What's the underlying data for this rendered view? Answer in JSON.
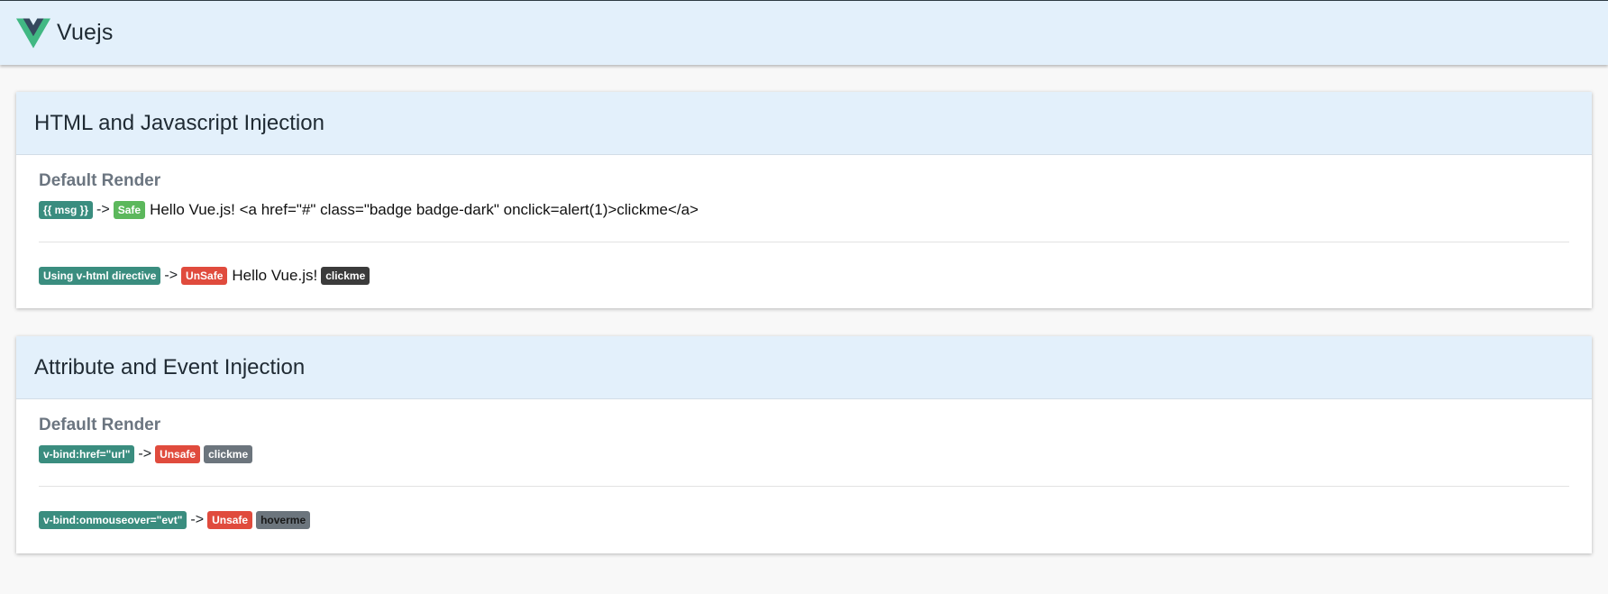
{
  "header": {
    "brand": "Vuejs",
    "logo_icon": "vue-logo-icon",
    "colors": {
      "logo_outer": "#41b883",
      "logo_inner": "#35495e",
      "bar_bg": "#e3f0fb"
    }
  },
  "cards": [
    {
      "title": "HTML and Javascript Injection",
      "section_title": "Default Render",
      "row1": {
        "badge1": "{{ msg }}",
        "arrow": "->",
        "badge2": "Safe",
        "text": "Hello Vue.js! <a href=\"#\" class=\"badge badge-dark\" onclick=alert(1)>clickme</a>"
      },
      "row2": {
        "badge1": "Using v-html directive",
        "arrow": "->",
        "badge2": "UnSafe",
        "text": "Hello Vue.js!",
        "link": "clickme"
      }
    },
    {
      "title": "Attribute and Event Injection",
      "section_title": "Default Render",
      "row1": {
        "badge1": "v-bind:href=\"url\"",
        "arrow": "->",
        "badge2": "Unsafe",
        "link": "clickme"
      },
      "row2": {
        "badge1": "v-bind:onmouseover=\"evt\"",
        "arrow": "->",
        "badge2": "Unsafe",
        "link": "hoverme"
      }
    }
  ],
  "colors": {
    "teal_badge": "#3a8d7f",
    "safe_badge": "#5cb85c",
    "unsafe_badge": "#e04b3d",
    "dark_badge": "#3b3b3b",
    "gray_badge": "#6c757d"
  }
}
